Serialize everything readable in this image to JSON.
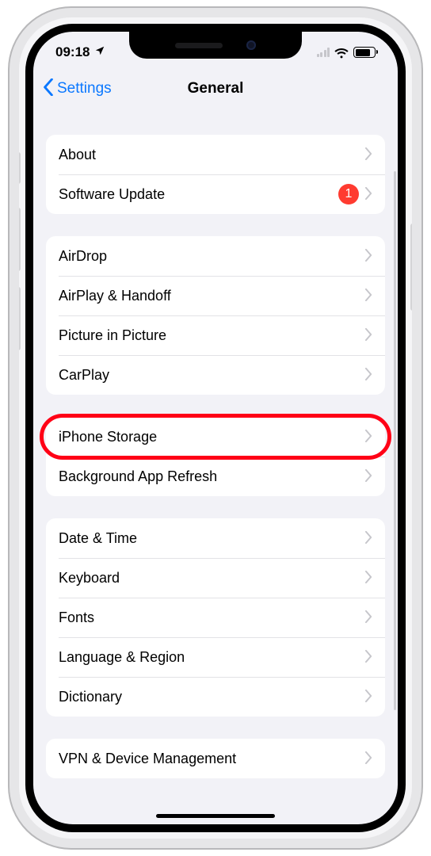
{
  "status": {
    "time": "09:18",
    "location_icon": "↗"
  },
  "nav": {
    "back_label": "Settings",
    "title": "General"
  },
  "groups": [
    {
      "rows": [
        {
          "id": "about",
          "label": "About"
        },
        {
          "id": "software-update",
          "label": "Software Update",
          "badge": "1"
        }
      ]
    },
    {
      "rows": [
        {
          "id": "airdrop",
          "label": "AirDrop"
        },
        {
          "id": "airplay-handoff",
          "label": "AirPlay & Handoff"
        },
        {
          "id": "picture-in-picture",
          "label": "Picture in Picture"
        },
        {
          "id": "carplay",
          "label": "CarPlay"
        }
      ]
    },
    {
      "rows": [
        {
          "id": "iphone-storage",
          "label": "iPhone Storage",
          "highlighted": true
        },
        {
          "id": "background-app-refresh",
          "label": "Background App Refresh"
        }
      ]
    },
    {
      "rows": [
        {
          "id": "date-time",
          "label": "Date & Time"
        },
        {
          "id": "keyboard",
          "label": "Keyboard"
        },
        {
          "id": "fonts",
          "label": "Fonts"
        },
        {
          "id": "language-region",
          "label": "Language & Region"
        },
        {
          "id": "dictionary",
          "label": "Dictionary"
        }
      ]
    },
    {
      "rows": [
        {
          "id": "vpn-device-mgmt",
          "label": "VPN & Device Management"
        }
      ]
    }
  ]
}
